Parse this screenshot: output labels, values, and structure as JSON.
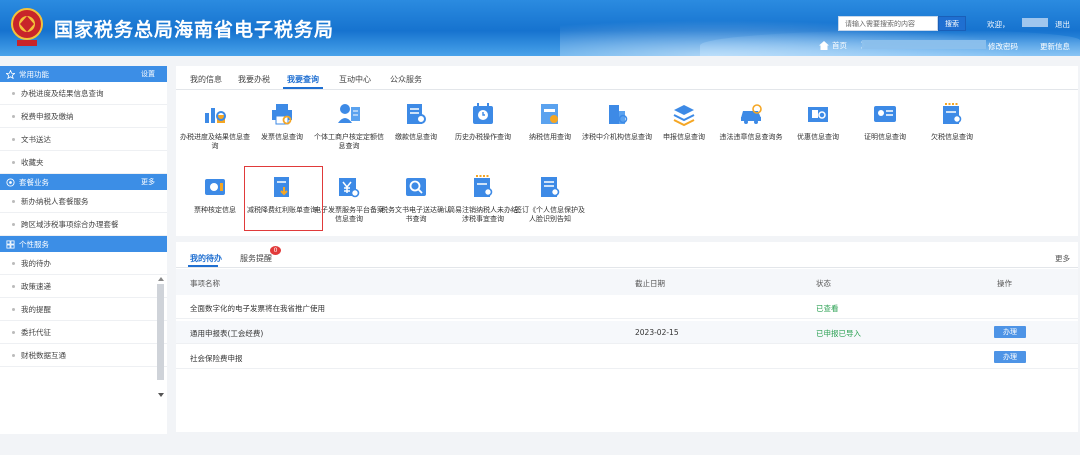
{
  "header": {
    "title": "国家税务总局海南省电子税务局",
    "search_placeholder": "请输入需要搜索的内容",
    "search_button": "搜索",
    "welcome": "欢迎，",
    "logout": "退出",
    "home": "首页",
    "home_prefix": "》",
    "change_password": "修改密码",
    "update_info": "更新信息"
  },
  "sidebar": {
    "sections": [
      {
        "title": "常用功能",
        "more": "设置",
        "items": [
          "办税进度及结果信息查询",
          "税费申报及缴纳",
          "文书送达",
          "收藏夹"
        ]
      },
      {
        "title": "套餐业务",
        "more": "更多",
        "items": [
          "新办纳税人套餐服务",
          "跨区域涉税事项综合办理套餐"
        ]
      },
      {
        "title": "个性服务",
        "more": "",
        "items": [
          "我的待办",
          "政策速递",
          "我的提醒",
          "委托代征",
          "财税数据互通"
        ]
      }
    ]
  },
  "top_tabs": [
    "我的信息",
    "我要办税",
    "我要查询",
    "互动中心",
    "公众服务"
  ],
  "icons_row1": [
    "办税进度及结果信息查询",
    "发票信息查询",
    "个体工商户核定定额信息查询",
    "缴款信息查询",
    "历史办税操作查询",
    "纳税信用查询",
    "涉税中介机构信息查询",
    "申报信息查询",
    "违法违章信息查询务",
    "优惠信息查询",
    "证明信息查询",
    "欠税信息查询"
  ],
  "icons_row2": [
    "票种核定信息",
    "减税降费红利账单查询",
    "电子发票服务平台备案信息查询",
    "税务文书电子送达确认书查询",
    "简易注销纳税人未办结涉税事宜查询",
    "签订《个人信息保护及人脸识别告知"
  ],
  "bottom_tabs": {
    "todo": "我的待办",
    "reminder": "服务提醒",
    "badge": "0",
    "more": "更多"
  },
  "table": {
    "headers": [
      "事项名称",
      "截止日期",
      "状态",
      "操作"
    ],
    "rows": [
      {
        "name": "全面数字化的电子发票将在我省推广使用",
        "deadline": "",
        "status": "已查看",
        "op": ""
      },
      {
        "name": "通用申报表(工会经费)",
        "deadline": "2023-02-15",
        "status": "已申报已导入",
        "op": "办理"
      },
      {
        "name": "社会保险费申报",
        "deadline": "",
        "status": "",
        "op": "办理"
      }
    ]
  },
  "colors": {
    "primary": "#1f6fd1",
    "sidebar_head": "#3c8ee6",
    "highlight": "#e03a3a",
    "status_green": "#2aa052"
  }
}
